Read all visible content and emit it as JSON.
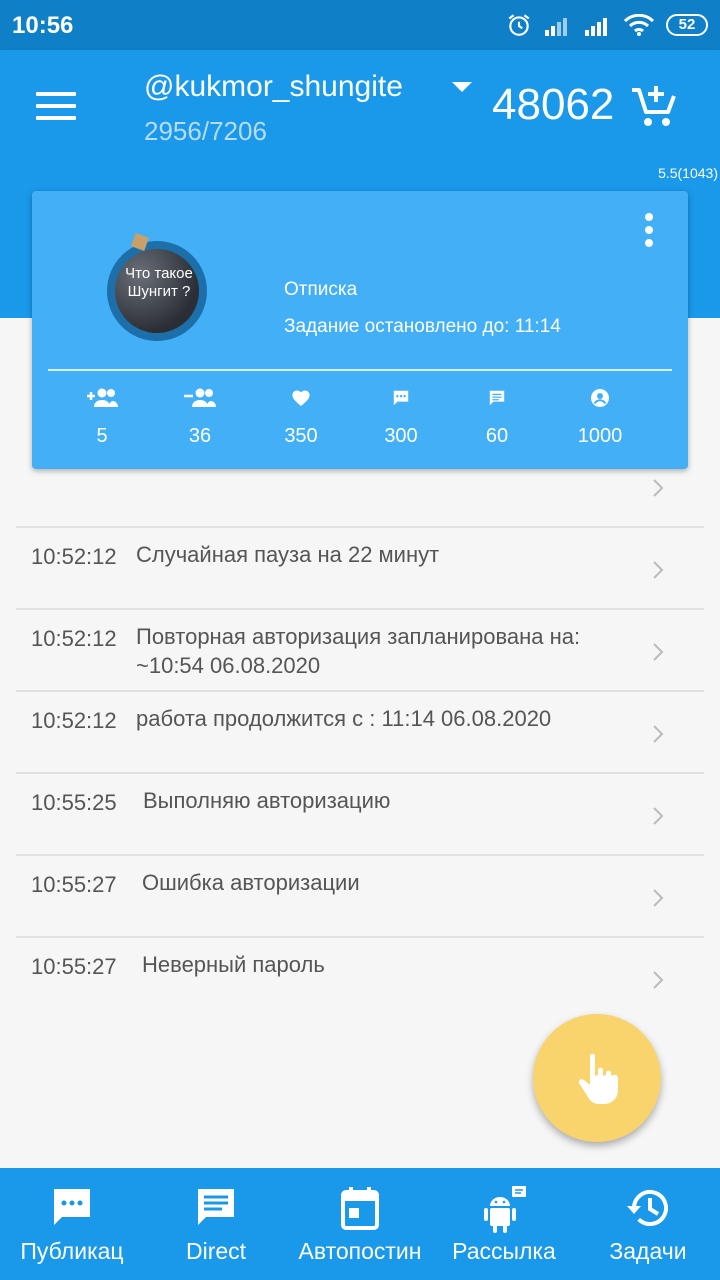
{
  "status_bar": {
    "time": "10:56",
    "battery": "52",
    "icons": [
      "alarm-icon",
      "signal-icon",
      "signal-icon",
      "wifi-icon",
      "battery-icon"
    ]
  },
  "app_bar": {
    "account_name": "@kukmor_shungite",
    "account_counter": "2956/7206",
    "balance": "48062",
    "version": "5.5(1043)"
  },
  "task_card": {
    "avatar_text": "Что такое Шунгит ?",
    "task_type": "Отписка",
    "task_status": "Задание остановлено до: 11:14",
    "stats": [
      {
        "icon": "follow-icon",
        "value": "5"
      },
      {
        "icon": "unfollow-icon",
        "value": "36"
      },
      {
        "icon": "like-icon",
        "value": "350"
      },
      {
        "icon": "comment-icon",
        "value": "300"
      },
      {
        "icon": "message-icon",
        "value": "60"
      },
      {
        "icon": "profile-icon",
        "value": "1000"
      }
    ]
  },
  "log": [
    {
      "time": "10:52:12",
      "message": "Случайная пауза на 22 минут"
    },
    {
      "time": "10:52:12",
      "message": "Повторная авторизация запланирована на: ~10:54 06.08.2020"
    },
    {
      "time": "10:52:12",
      "message": "работа продолжится с : 11:14 06.08.2020"
    },
    {
      "time": "10:55:25",
      "message": "Выполняю авторизацию"
    },
    {
      "time": "10:55:27",
      "message": "Ошибка авторизации"
    },
    {
      "time": "10:55:27",
      "message": "Неверный пароль"
    }
  ],
  "bottom_nav": [
    {
      "label": "Публикац",
      "icon": "chat-dots-icon"
    },
    {
      "label": "Direct",
      "icon": "message-icon"
    },
    {
      "label": "Автопостин",
      "icon": "calendar-icon"
    },
    {
      "label": "Рассылка",
      "icon": "android-icon"
    },
    {
      "label": "Задачи",
      "icon": "history-icon"
    }
  ],
  "colors": {
    "status_bar": "#0f7fc7",
    "primary": "#1a98e9",
    "card": "#42aff7",
    "fab": "#f9d46d"
  }
}
